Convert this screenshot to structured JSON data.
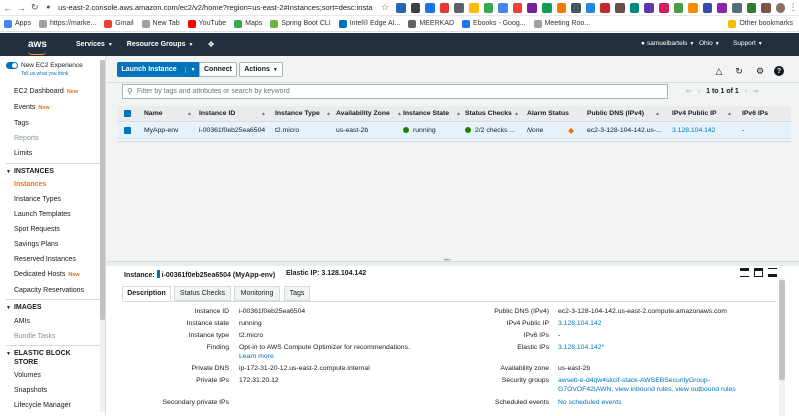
{
  "browser": {
    "url": "us-east-2.console.aws.amazon.com/ec2/v2/home?region=us-east-2#Instances;sort=desc:instance...",
    "bookmarks": [
      "Apps",
      "https://marke...",
      "Gmail",
      "New Tab",
      "YouTube",
      "Maps",
      "Spring Boot CLI",
      "Intel® Edge AI...",
      "MEERKAD",
      "Ebooks - Goog...",
      "Meeting Roo..."
    ],
    "other_bookmarks": "Other bookmarks"
  },
  "aws_nav": {
    "logo": "aws",
    "services": "Services",
    "resource_groups": "Resource Groups",
    "user": "samuelbartels",
    "region": "Ohio",
    "support": "Support"
  },
  "sidebar": {
    "new_experience": "New EC2 Experience",
    "new_experience_sub": "Tell us what you think",
    "items_top": [
      {
        "label": "EC2 Dashboard",
        "badge": "New"
      },
      {
        "label": "Events",
        "badge": "New"
      },
      {
        "label": "Tags",
        "badge": ""
      },
      {
        "label": "Reports",
        "badge": ""
      },
      {
        "label": "Limits",
        "badge": ""
      }
    ],
    "section_instances": "INSTANCES",
    "instances_items": [
      {
        "label": "Instances",
        "badge": ""
      },
      {
        "label": "Instance Types",
        "badge": ""
      },
      {
        "label": "Launch Templates",
        "badge": ""
      },
      {
        "label": "Spot Requests",
        "badge": ""
      },
      {
        "label": "Savings Plans",
        "badge": ""
      },
      {
        "label": "Reserved Instances",
        "badge": ""
      },
      {
        "label": "Dedicated Hosts",
        "badge": "New"
      },
      {
        "label": "Capacity Reservations",
        "badge": ""
      }
    ],
    "section_images": "IMAGES",
    "images_items": [
      "AMIs",
      "Bundle Tasks"
    ],
    "section_ebs_1": "ELASTIC BLOCK",
    "section_ebs_2": "STORE",
    "ebs_items": [
      "Volumes",
      "Snapshots",
      "Lifecycle Manager"
    ]
  },
  "toolbar": {
    "launch": "Launch Instance",
    "connect": "Connect",
    "actions": "Actions"
  },
  "filter": {
    "placeholder": "Filter by tags and attributes or search by keyword"
  },
  "pager": {
    "text": "1 to 1 of 1"
  },
  "table": {
    "columns": [
      "Name",
      "Instance ID",
      "Instance Type",
      "Availability Zone",
      "Instance State",
      "Status Checks",
      "Alarm Status",
      "Public DNS (IPv4)",
      "IPv4 Public IP",
      "IPv6 IPs"
    ],
    "row": {
      "name": "MyApp-env",
      "instance_id": "i-00361f0eb25ea6504",
      "instance_type": "t2.micro",
      "zone": "us-east-2b",
      "state": "running",
      "status_checks": "2/2 checks ...",
      "alarm": "None",
      "public_dns": "ec2-3-128-104-142.us-...",
      "ipv4": "3.128.104.142",
      "ipv6": "-"
    }
  },
  "detail": {
    "instance_label": "Instance:",
    "instance_value": "i-00361f0eb25ea6504 (MyApp-env)",
    "elastic_ip_label": "Elastic IP: 3.128.104.142",
    "tabs": [
      "Description",
      "Status Checks",
      "Monitoring",
      "Tags"
    ],
    "left": [
      {
        "label": "Instance ID",
        "value": "i-00361f0eb25ea6504"
      },
      {
        "label": "Instance state",
        "value": "running"
      },
      {
        "label": "Instance type",
        "value": "t2.micro"
      },
      {
        "label": "Finding",
        "value": "Opt-in to AWS Compute Optimizer for recommendations."
      },
      {
        "label": "Private DNS",
        "value": "ip-172-31-20-12.us-east-2.compute.internal"
      },
      {
        "label": "Private IPs",
        "value": "172.31.20.12"
      },
      {
        "label": "Secondary private IPs",
        "value": ""
      }
    ],
    "learn_more": "Learn more",
    "right": [
      {
        "label": "Public DNS (IPv4)",
        "value": "ec2-3-128-104-142.us-east-2.compute.amazonaws.com"
      },
      {
        "label": "IPv4 Public IP",
        "value": "3.128.104.142"
      },
      {
        "label": "IPv6 IPs",
        "value": "-"
      },
      {
        "label": "Elastic IPs",
        "value": "3.128.104.142*"
      },
      {
        "label": "Availability zone",
        "value": "us-east-2b"
      },
      {
        "label": "Security groups",
        "value": "awseb-e-d4qw4skcif-stack-AWSEBSecurityGroup-"
      },
      {
        "label": "Scheduled events",
        "value": "No scheduled events"
      }
    ],
    "sg_line2": "G7OVOF42IAWN.",
    "sg_view_inbound": "view inbound rules.",
    "sg_view_outbound": "view outbound rules"
  },
  "colors": {
    "aws_nav": "#232f3e",
    "accent_orange": "#ec7211",
    "primary_blue": "#0073bb",
    "running_green": "#1d8102"
  }
}
